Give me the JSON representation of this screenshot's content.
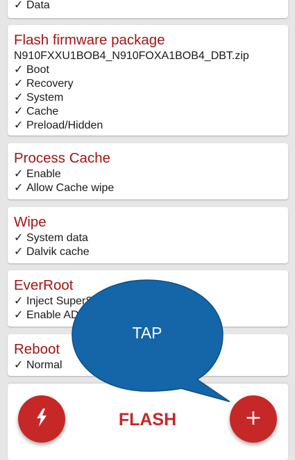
{
  "colors": {
    "title_red": "#a31515",
    "accent_red": "#c62828",
    "bubble_blue": "#1565a9",
    "bubble_border": "#0b4f88"
  },
  "check_glyph": "✓",
  "cards": {
    "data_partial": {
      "items": [
        "Data"
      ]
    },
    "flash_firmware": {
      "title": "Flash firmware package",
      "filename": "N910FXXU1BOB4_N910FOXA1BOB4_DBT.zip",
      "items": [
        "Boot",
        "Recovery",
        "System",
        "Cache",
        "Preload/Hidden"
      ]
    },
    "process_cache": {
      "title": "Process Cache",
      "items": [
        "Enable",
        "Allow Cache wipe"
      ]
    },
    "wipe": {
      "title": "Wipe",
      "items": [
        "System data",
        "Dalvik cache"
      ]
    },
    "everroot": {
      "title": "EverRoot",
      "items": [
        "Inject SuperS",
        "Enable AD"
      ]
    },
    "reboot": {
      "title": "Reboot",
      "items": [
        "Normal"
      ]
    }
  },
  "bottom_bar": {
    "flash_label": "FLASH",
    "flash_icon": "lightning-bolt-icon",
    "add_icon": "plus-icon",
    "add_symbol": "+"
  },
  "callout": {
    "label": "TAP"
  }
}
